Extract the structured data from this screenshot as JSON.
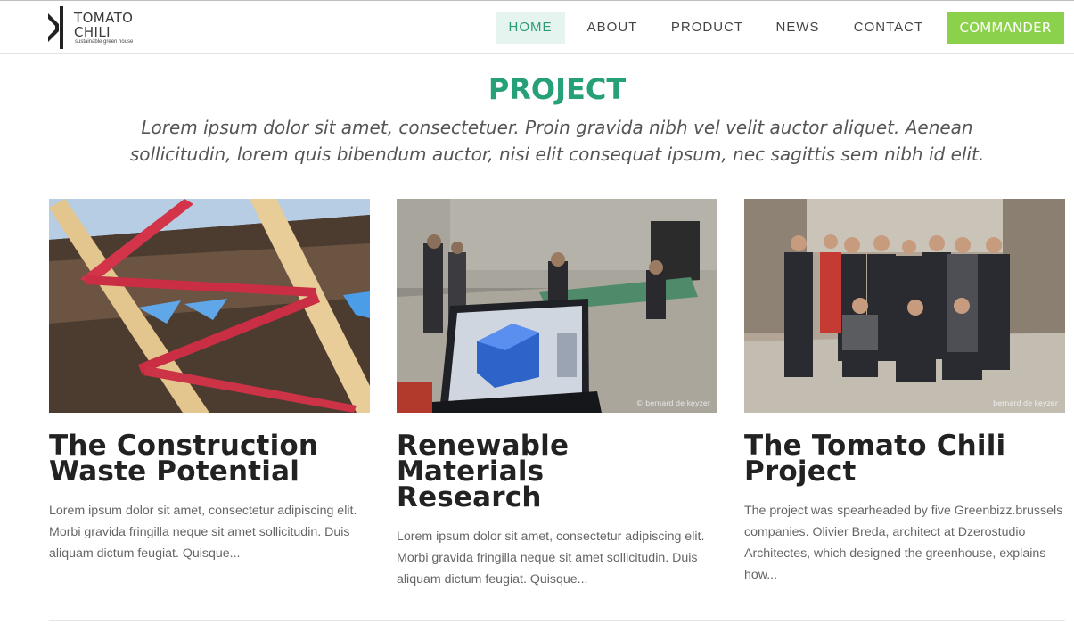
{
  "brand": {
    "name_line1": "TOMATO",
    "name_line2": "CHILI",
    "tagline": "sustainable green house"
  },
  "nav": {
    "items": [
      "HOME",
      "ABOUT",
      "PRODUCT",
      "NEWS",
      "CONTACT"
    ],
    "active": "HOME",
    "cta_label": "COMMANDER"
  },
  "section": {
    "title": "PROJECT",
    "subtitle": "Lorem ipsum dolor sit amet, consectetuer. Proin gravida nibh vel velit auctor aliquet. Aenean sollicitudin, lorem quis bibendum auctor, nisi elit consequat ipsum, nec sagittis sem nibh id elit."
  },
  "cards": [
    {
      "title_line1": "The Construction",
      "title_line2": "Waste Potential",
      "text": "Lorem ipsum dolor sit amet, consectetur adipiscing elit. Morbi gravida fringilla neque sit amet sollicitudin. Duis aliquam dictum feugiat. Quisque...",
      "image": "wooden-truss-photo"
    },
    {
      "title_line1": "Renewable Materials",
      "title_line2": "Research",
      "text": "Lorem ipsum dolor sit amet, consectetur adipiscing elit. Morbi gravida fringilla neque sit amet sollicitudin. Duis aliquam dictum feugiat. Quisque...",
      "image": "tablet-greenhouse-photo",
      "watermark": "© bernard de keyzer"
    },
    {
      "title_line1": "The Tomato Chili",
      "title_line2": "Project",
      "text": "The project was spearheaded by five Greenbizz.brussels companies. Olivier Breda, architect at Dzerostudio Architectes, which designed the greenhouse, explains how...",
      "image": "team-group-photo",
      "watermark": "bernard de keyzer"
    }
  ],
  "colors": {
    "accent": "#25a079",
    "nav_active_bg": "#e6f4ef",
    "cta_bg": "#8cd14b"
  }
}
